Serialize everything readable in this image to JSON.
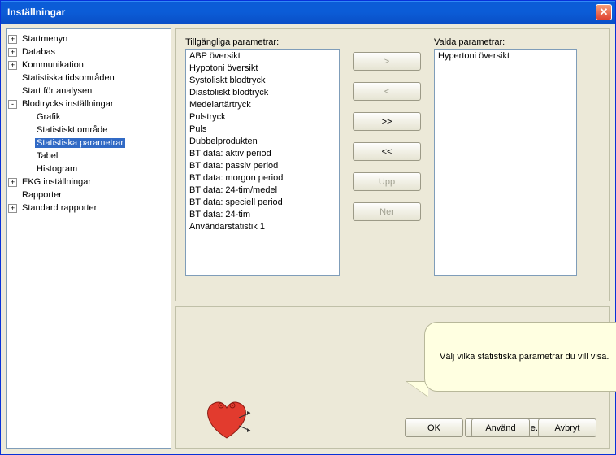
{
  "window": {
    "title": "Inställningar"
  },
  "tree": [
    {
      "label": "Startmenyn",
      "indent": 0,
      "exp": "+"
    },
    {
      "label": "Databas",
      "indent": 0,
      "exp": "+"
    },
    {
      "label": "Kommunikation",
      "indent": 0,
      "exp": "+"
    },
    {
      "label": "Statistiska tidsområden",
      "indent": 0,
      "exp": ""
    },
    {
      "label": "Start för analysen",
      "indent": 0,
      "exp": ""
    },
    {
      "label": "Blodtrycks inställningar",
      "indent": 0,
      "exp": "-"
    },
    {
      "label": "Grafik",
      "indent": 1,
      "exp": ""
    },
    {
      "label": "Statistiskt område",
      "indent": 1,
      "exp": ""
    },
    {
      "label": "Statistiska parametrar",
      "indent": 1,
      "exp": "",
      "selected": true
    },
    {
      "label": "Tabell",
      "indent": 1,
      "exp": ""
    },
    {
      "label": "Histogram",
      "indent": 1,
      "exp": ""
    },
    {
      "label": "EKG inställningar",
      "indent": 0,
      "exp": "+"
    },
    {
      "label": "Rapporter",
      "indent": 0,
      "exp": ""
    },
    {
      "label": "Standard rapporter",
      "indent": 0,
      "exp": "+"
    }
  ],
  "labels": {
    "available": "Tillgängliga parametrar:",
    "selected": "Valda parametrar:"
  },
  "available_params": [
    "ABP översikt",
    "Hypotoni översikt",
    "Systoliskt blodtryck",
    "Diastoliskt blodtryck",
    "Medelartärtryck",
    "Pulstryck",
    "Puls",
    "Dubbelprodukten",
    "BT data: aktiv period",
    "BT data: passiv period",
    "BT data: morgon period",
    "BT data: 24-tim/medel",
    "BT data: speciell period",
    "BT data: 24-tim",
    "Användarstatistik 1"
  ],
  "selected_params": [
    "Hypertoni översikt"
  ],
  "transfer": {
    "add": ">",
    "remove": "<",
    "add_all": ">>",
    "remove_all": "<<",
    "up": "Upp",
    "down": "Ner"
  },
  "help_text": "Välj vilka statistiska parametrar du vill visa.",
  "buttons": {
    "predef": "Fördefinierade...",
    "ok": "OK",
    "apply": "Använd",
    "cancel": "Avbryt"
  }
}
